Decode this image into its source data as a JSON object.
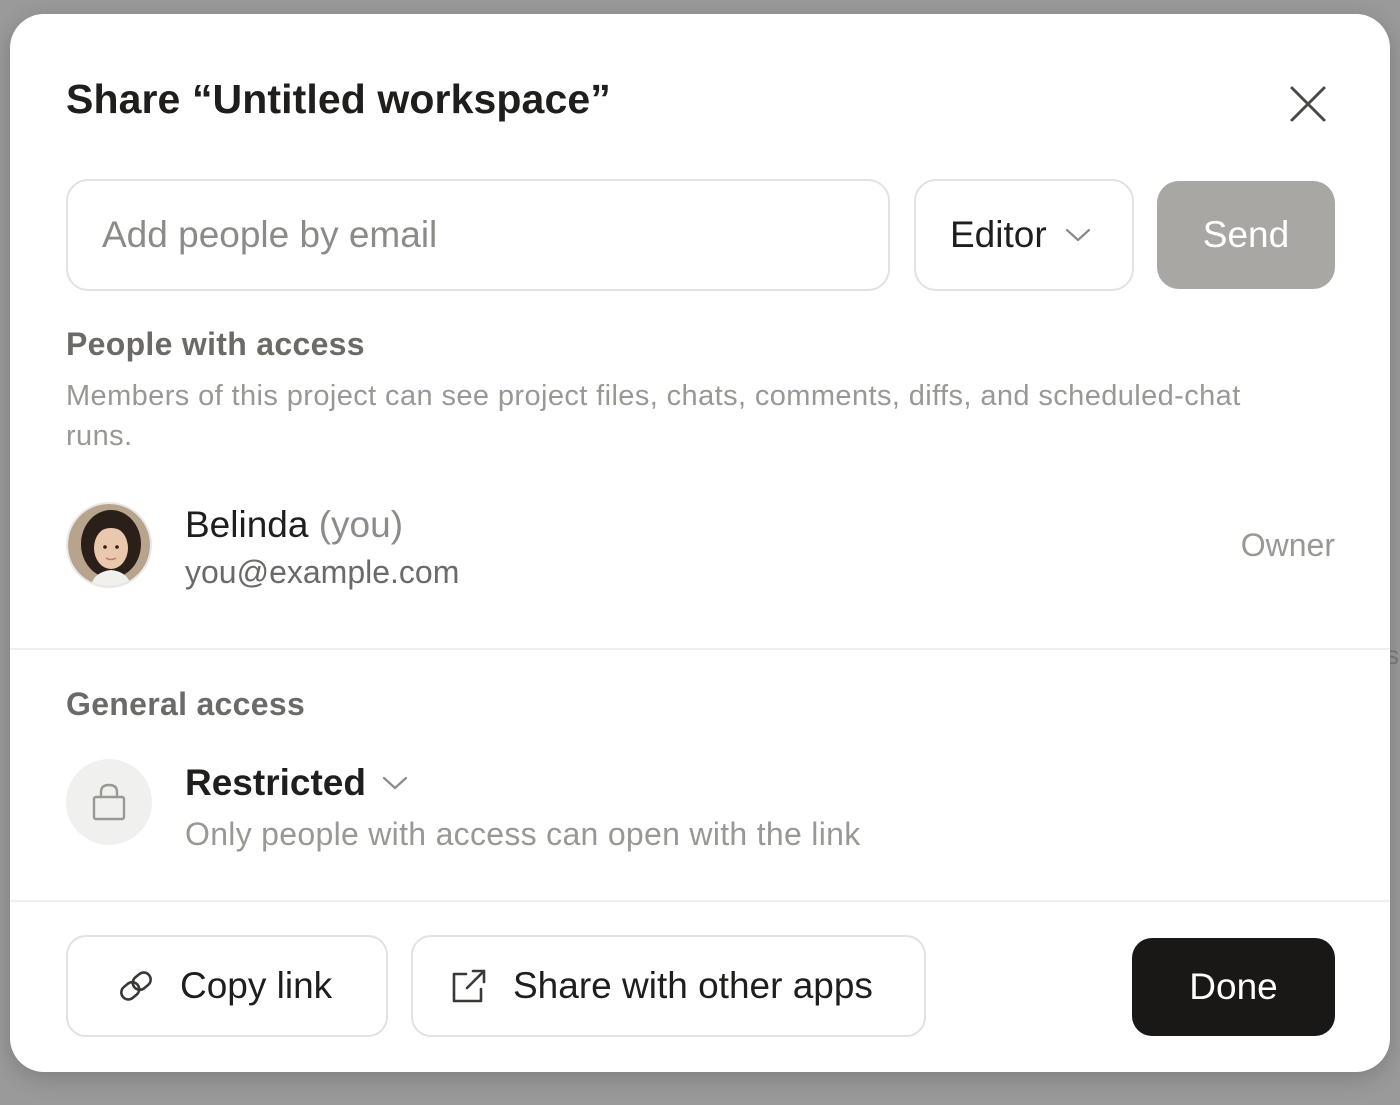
{
  "dialog": {
    "title": "Share “Untitled workspace”",
    "close_icon": "close-icon"
  },
  "invite": {
    "email_placeholder": "Add people by email",
    "email_value": "",
    "role_value": "Editor",
    "send_label": "Send"
  },
  "people_section": {
    "title": "People with access",
    "description": "Members of this project can see project files, chats, comments, diffs, and scheduled-chat runs.",
    "members": [
      {
        "name": "Belinda",
        "you_suffix": "(you)",
        "email": "you@example.com",
        "role": "Owner"
      }
    ]
  },
  "general_access": {
    "title": "General access",
    "level": "Restricted",
    "description": "Only people with access can open with the link",
    "icon": "lock-icon"
  },
  "footer": {
    "copy_link_label": "Copy link",
    "share_apps_label": "Share with other apps",
    "done_label": "Done"
  },
  "colors": {
    "send_disabled": "#a8a7a4",
    "done_bg": "#1a1817",
    "backdrop": "#9a9a9a"
  }
}
